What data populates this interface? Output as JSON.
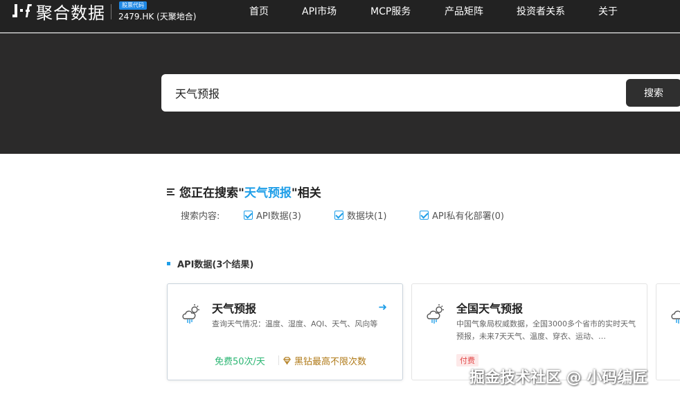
{
  "header": {
    "logo_text": "聚合数据",
    "stock_badge": "股票代码",
    "stock_text": "2479.HK (天聚地合)",
    "nav": [
      "首页",
      "API市场",
      "MCP服务",
      "产品矩阵",
      "投资者关系",
      "关于"
    ]
  },
  "search": {
    "value": "天气预报",
    "button_label": "搜索"
  },
  "results": {
    "title_prefix": "您正在搜索\"",
    "keyword": "天气预报",
    "title_suffix": "\"相关",
    "filter_label": "搜索内容:",
    "filters": [
      "API数据(3)",
      "数据块(1)",
      "API私有化部署(0)"
    ],
    "section_title": "API数据(3个结果)"
  },
  "cards": [
    {
      "title": "天气预报",
      "desc": "查询天气情况：温度、湿度、AQI、天气、风向等",
      "free": "免费50次/天",
      "vip": "黑钻最高不限次数",
      "arrow": "➜"
    },
    {
      "title": "全国天气预报",
      "desc": "中国气象局权威数据，全国3000多个省市的实时天气预报，未来7天天气、温度、穿衣、运动、…",
      "tag": "付费"
    }
  ],
  "watermark": "掘金技术社区 @ 小码编匠",
  "colors": {
    "accent": "#1e9ee8",
    "dark": "#222222",
    "free": "#2bb673",
    "vip": "#b07a18",
    "paid": "#e24a4a"
  }
}
